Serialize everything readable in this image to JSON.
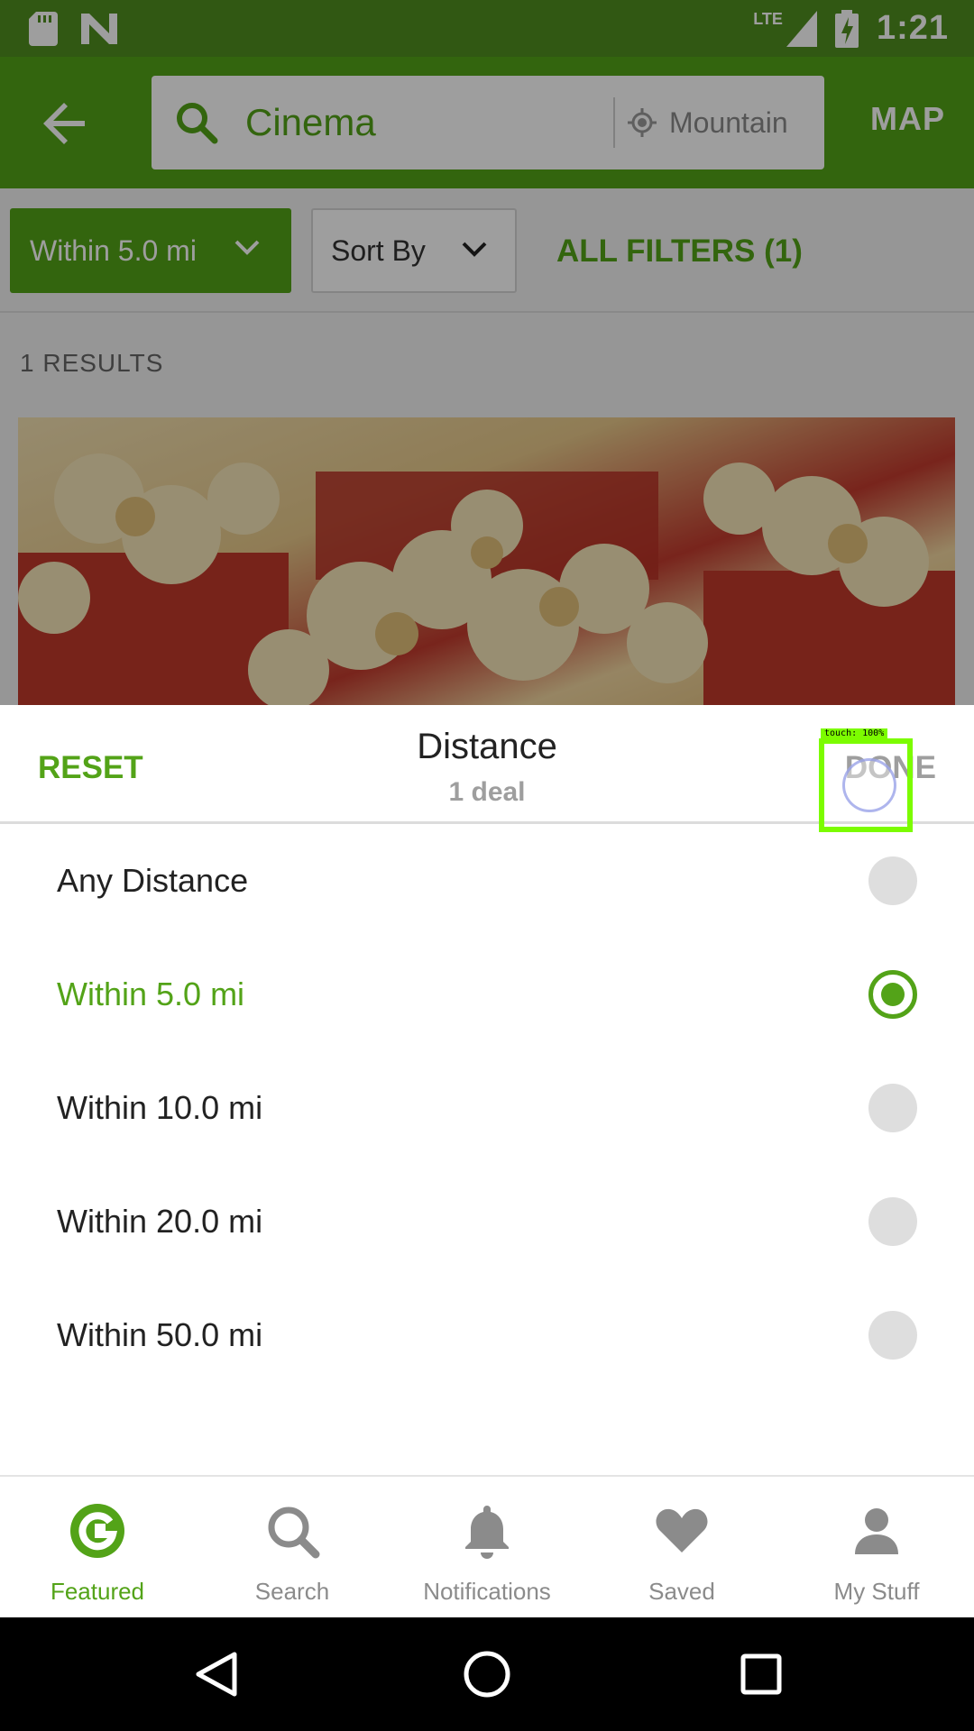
{
  "status_bar": {
    "network": "LTE",
    "time": "1:21"
  },
  "app_bar": {
    "search_query": "Cinema",
    "location": "Mountain View",
    "map_label": "MAP"
  },
  "filters": {
    "distance_chip": "Within 5.0 mi",
    "sort_chip": "Sort By",
    "all_filters": "ALL FILTERS (1)"
  },
  "results": {
    "count_label": "1 RESULTS"
  },
  "sheet": {
    "reset_label": "RESET",
    "title": "Distance",
    "subtitle": "1 deal",
    "done_label": "DONE",
    "touch_label": "touch: 100%",
    "options": [
      {
        "label": "Any Distance",
        "selected": false
      },
      {
        "label": "Within 5.0 mi",
        "selected": true
      },
      {
        "label": "Within 10.0 mi",
        "selected": false
      },
      {
        "label": "Within 20.0 mi",
        "selected": false
      },
      {
        "label": "Within 50.0 mi",
        "selected": false
      }
    ]
  },
  "bottom_nav": {
    "items": [
      {
        "label": "Featured",
        "icon": "groupon-g-icon",
        "active": true
      },
      {
        "label": "Search",
        "icon": "search-icon",
        "active": false
      },
      {
        "label": "Notifications",
        "icon": "bell-icon",
        "active": false
      },
      {
        "label": "Saved",
        "icon": "heart-icon",
        "active": false
      },
      {
        "label": "My Stuff",
        "icon": "person-icon",
        "active": false
      }
    ]
  },
  "colors": {
    "brand_green": "#53a318",
    "status_green": "#4f8f1f",
    "inactive_gray": "#8b8b8b"
  }
}
